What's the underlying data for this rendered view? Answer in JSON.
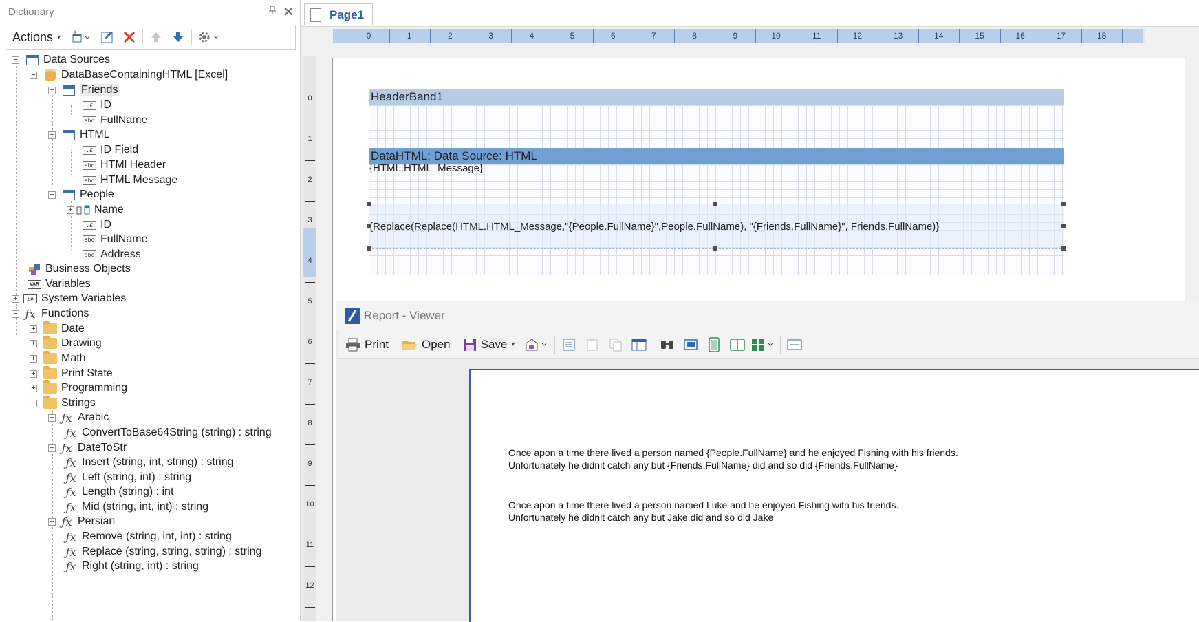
{
  "dictionary": {
    "title": "Dictionary",
    "actions_label": "Actions",
    "tree": {
      "data_sources": "Data Sources",
      "database": "DataBaseContainingHTML [Excel]",
      "friends": "Friends",
      "friends_id": "ID",
      "friends_fullname": "FullName",
      "html": "HTML",
      "html_id_field": "ID Field",
      "html_header": "HTMl Header",
      "html_message": "HTML Message",
      "people": "People",
      "people_name": "Name",
      "people_id": "ID",
      "people_fullname": "FullName",
      "people_address": "Address",
      "business_objects": "Business Objects",
      "variables": "Variables",
      "system_variables": "System Variables",
      "functions": "Functions",
      "date": "Date",
      "drawing": "Drawing",
      "math": "Math",
      "print_state": "Print State",
      "programming": "Programming",
      "strings": "Strings",
      "arabic": "Arabic",
      "convert_b64": "ConvertToBase64String (string) : string",
      "datetostr": "DateToStr",
      "insert": "Insert (string, int, string) : string",
      "left": "Left (string, int) : string",
      "length": "Length (string) : int",
      "mid": "Mid (string, int, int) : string",
      "persian": "Persian",
      "remove": "Remove (string, int, int) : string",
      "replace": "Replace (string, string, string) : string",
      "right": "Right (string, int) : string"
    }
  },
  "designer": {
    "tab_label": "Page1",
    "ruler_numbers": [
      "0",
      "1",
      "2",
      "3",
      "4",
      "5",
      "6",
      "7",
      "8",
      "9",
      "10",
      "11",
      "12",
      "13",
      "14",
      "15",
      "16",
      "17",
      "18"
    ],
    "vruler_numbers": [
      "0",
      "1",
      "2",
      "3",
      "4",
      "5",
      "6",
      "7",
      "8",
      "9",
      "10",
      "11",
      "12"
    ],
    "header_band": "HeaderBand1",
    "data_band": "DataHTML; Data Source: HTML",
    "data_text_1": "{HTML.HTML_Message}",
    "data_text_2": "{Replace(Replace(HTML.HTML_Message,\"{People.FullName}\",People.FullName), \"{Friends.FullName}\", Friends.FullName)}",
    "colors": {
      "header_band": "#b8cbe4",
      "data_band": "#6f9fd3"
    }
  },
  "viewer": {
    "title": "Report - Viewer",
    "print": "Print",
    "open": "Open",
    "save": "Save",
    "line1": "Once apon a time there lived a person named {People.FullName} and he enjoyed Fishing with his friends.",
    "line2": "Unfortunately he didnit catch any but {Friends.FullName} did and so did {Friends.FullName}",
    "line3": "Once apon a time there lived a person named Luke and he enjoyed Fishing with his friends.",
    "line4": "Unfortunately he didnit catch any but Jake did and so did Jake"
  }
}
